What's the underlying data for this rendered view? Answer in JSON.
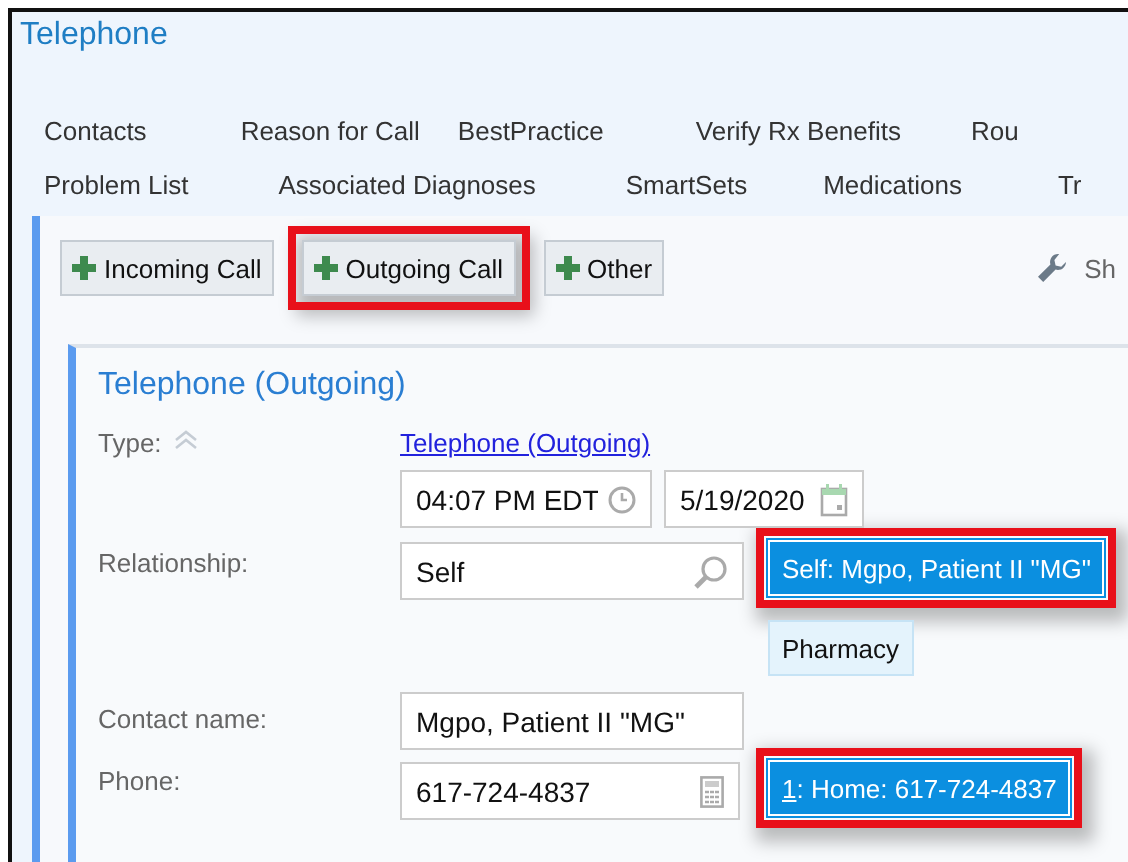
{
  "window": {
    "title": "Telephone"
  },
  "tab_rows": [
    [
      "Contacts",
      "Reason for Call",
      "BestPractice",
      "Verify Rx Benefits",
      "Rou"
    ],
    [
      "Problem List",
      "Associated Diagnoses",
      "SmartSets",
      "Medications",
      "Tr"
    ]
  ],
  "toolbar": {
    "buttons": [
      {
        "label": "Incoming Call",
        "highlighted": false
      },
      {
        "label": "Outgoing Call",
        "highlighted": true
      },
      {
        "label": "Other",
        "highlighted": false
      }
    ],
    "settings_label": "Sh"
  },
  "form": {
    "title": "Telephone (Outgoing)",
    "type": {
      "label": "Type:",
      "link": "Telephone (Outgoing)",
      "time": "04:07 PM EDT",
      "date": "5/19/2020"
    },
    "relationship": {
      "label": "Relationship:",
      "value": "Self",
      "choices": [
        {
          "label": "Self: Mgpo, Patient II \"MG\"",
          "selected": true,
          "highlighted": true
        },
        {
          "label": "Pharmacy",
          "selected": false,
          "highlighted": false
        }
      ]
    },
    "contact_name": {
      "label": "Contact name:",
      "value": "Mgpo, Patient II \"MG\""
    },
    "phone": {
      "label": "Phone:",
      "value": "617-724-4837",
      "choices": [
        {
          "key": "1",
          "label": ": Home: 617-724-4837",
          "selected": true,
          "highlighted": true
        }
      ]
    }
  }
}
